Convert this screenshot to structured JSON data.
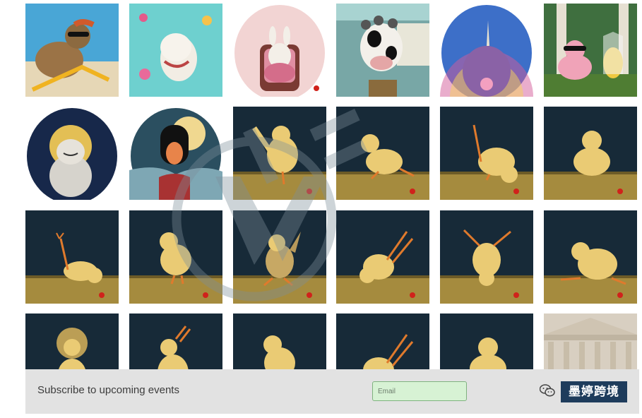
{
  "gallery": {
    "tiles": [
      {
        "id": "seal-sunbathing",
        "kind": "rect",
        "bg": "#49a6d6",
        "subject": "seal"
      },
      {
        "id": "goat-candy",
        "kind": "rect",
        "bg": "#6ed0cf",
        "subject": "goat"
      },
      {
        "id": "bunny-chair",
        "kind": "oval",
        "bg": "#f2d4d3",
        "subject": "bunny"
      },
      {
        "id": "cow-curlers",
        "kind": "rect",
        "bg": "#78a7a6",
        "subject": "cow"
      },
      {
        "id": "narwhal-rainbow",
        "kind": "oval",
        "bg": "#3d6fc8",
        "subject": "narwhal"
      },
      {
        "id": "pig-and-chick",
        "kind": "rect",
        "bg": "#3f6f3f",
        "subject": "pig"
      },
      {
        "id": "seal-halo",
        "kind": "oval",
        "bg": "#17284a",
        "subject": "seal-halo"
      },
      {
        "id": "duck-girl-moon",
        "kind": "oval",
        "bg": "#2b4f60",
        "subject": "duck-girl"
      },
      {
        "id": "chick-pose-1",
        "kind": "chick",
        "pose": "wing-up"
      },
      {
        "id": "chick-pose-2",
        "kind": "chick",
        "pose": "lunge"
      },
      {
        "id": "chick-pose-3",
        "kind": "chick",
        "pose": "bend"
      },
      {
        "id": "chick-pose-4",
        "kind": "chick",
        "pose": "sit"
      },
      {
        "id": "chick-pose-5",
        "kind": "chick",
        "pose": "leg-up"
      },
      {
        "id": "chick-pose-6",
        "kind": "chick",
        "pose": "stand"
      },
      {
        "id": "chick-pose-7",
        "kind": "chick",
        "pose": "wings"
      },
      {
        "id": "chick-pose-8",
        "kind": "chick",
        "pose": "plank"
      },
      {
        "id": "chick-pose-9",
        "kind": "chick",
        "pose": "headstand"
      },
      {
        "id": "chick-pose-10",
        "kind": "chick",
        "pose": "stretch"
      },
      {
        "id": "chick-halo",
        "kind": "chick",
        "pose": "halo"
      },
      {
        "id": "chick-pose-11",
        "kind": "chick",
        "pose": "reach"
      },
      {
        "id": "chick-pose-12",
        "kind": "chick",
        "pose": "stand"
      },
      {
        "id": "chick-pose-13",
        "kind": "chick",
        "pose": "plank"
      },
      {
        "id": "chick-pose-14",
        "kind": "chick",
        "pose": "sit"
      },
      {
        "id": "bison-building",
        "kind": "building",
        "bg": "#d8cfc1"
      }
    ]
  },
  "subscribe": {
    "label": "Subscribe to upcoming events",
    "email_placeholder": "Email"
  },
  "brand": {
    "badge_text": "墨婷跨境",
    "icon": "wechat-icon"
  },
  "colors": {
    "night_sky": "#172a38",
    "floor": "#a58b3e",
    "chick": "#eacb74",
    "signature_dot": "#d0221b",
    "bar_bg": "#e2e2e2",
    "input_bg": "#d7f2d4",
    "badge_bg": "#1e3c5c"
  }
}
